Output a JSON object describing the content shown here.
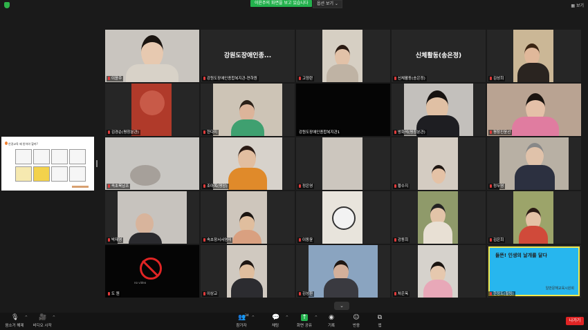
{
  "topbar": {
    "share_banner": "이윤주의 화면을 보고 있습니다",
    "view_options": "옵션 보기",
    "view_options_caret": "⌄",
    "view_button": "보기"
  },
  "slide": {
    "title": "안경교육 왜 받아야 할까?"
  },
  "tiles": [
    {
      "name": "이윤주",
      "active": true
    },
    {
      "name": "강원도장애인종합복지관-연하원",
      "label": "강원도장애인종..."
    },
    {
      "name": "고정란"
    },
    {
      "name": "신체활동(송은정)",
      "label": "신체활동(송은정)"
    },
    {
      "name": "김성희"
    },
    {
      "name": "김경순(평창분관)"
    },
    {
      "name": "한다미"
    },
    {
      "name": "강원도장애인종합복지관1"
    },
    {
      "name": "방화석(평창분관)"
    },
    {
      "name": "평창진윤선"
    },
    {
      "name": "속초육남조"
    },
    {
      "name": "조아목(명암)"
    },
    {
      "name": "정은영"
    },
    {
      "name": "황수지"
    },
    {
      "name": "정두영"
    },
    {
      "name": "박재영"
    },
    {
      "name": "속초장서서영미"
    },
    {
      "name": "이동윤"
    },
    {
      "name": "강동희"
    },
    {
      "name": "김은희"
    },
    {
      "name": "도 원"
    },
    {
      "name": "이상교"
    },
    {
      "name": "김성환"
    },
    {
      "name": "차은옥"
    },
    {
      "name": "한정도(힐링)"
    }
  ],
  "blue_card": {
    "headline": "들뜬! 인생의 날개를 달다",
    "sub": "일반문해교육시원회"
  },
  "nocam_caption": "no video",
  "toolbar": {
    "mute": "음소거 해제",
    "video": "비디오 시작",
    "participants": "참가자",
    "participants_count": "34",
    "chat": "채팅",
    "share": "화면 공유",
    "record": "기록",
    "reactions": "반응",
    "apps": "앱",
    "leave": "나가기",
    "caret": "^",
    "chevron": "⌄"
  },
  "colors": {
    "share_green": "#23b14d",
    "leave_red": "#e02424",
    "active_outline": "#e6e84a",
    "blue_card": "#27b6ee"
  }
}
